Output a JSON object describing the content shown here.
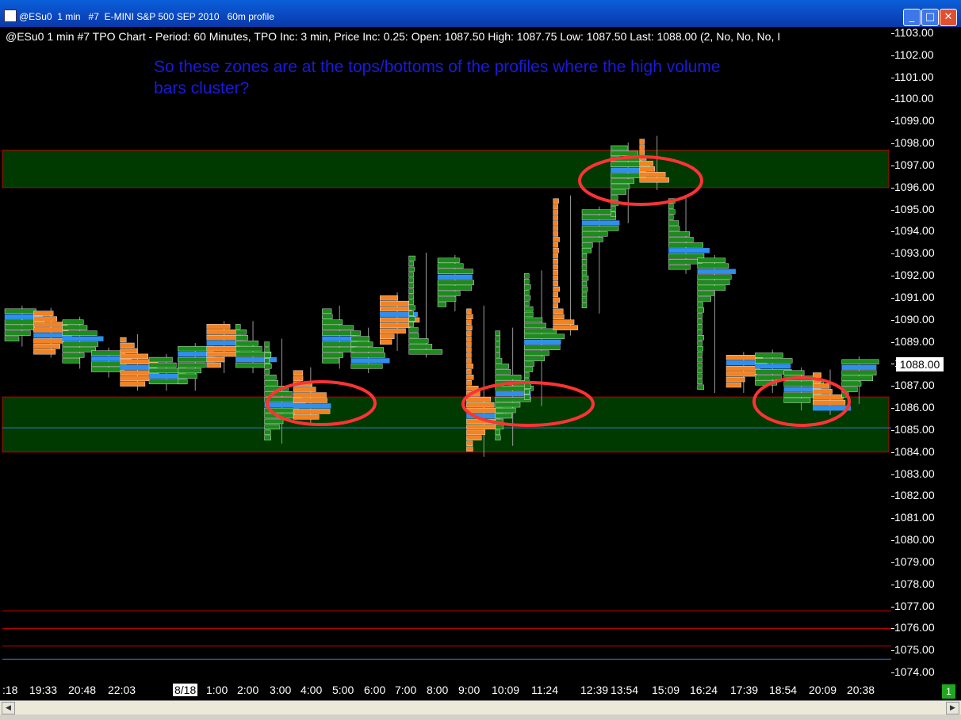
{
  "window": {
    "title": "@ESu0  1 min   #7  E-MINI S&P 500 SEP 2010   60m profile",
    "minimize": "_",
    "maximize": "□",
    "close": "✕"
  },
  "info_line": "@ESu0  1 min  #7 TPO Chart - Period: 60 Minutes, TPO Inc: 3 min, Price Inc: 0.25:  Open: 1087.50  High: 1087.75  Low: 1087.50  Last: 1088.00  (2, No, No, No, I",
  "annotation": {
    "line1": "So these zones are at the tops/bottoms of the profiles where the high volume",
    "line2": "bars cluster?"
  },
  "last_price": "1088.00",
  "status_badge": "1",
  "colors": {
    "background": "#000000",
    "zone_fill": "#003a00",
    "zone_border": "#c00000",
    "red_line": "#d00000",
    "blue_line": "#2a7bd6",
    "tpo_green": "#1c8c1c",
    "tpo_orange": "#f58220",
    "tpo_blue": "#2f8fef",
    "circle": "#ff3333"
  },
  "chart_data": {
    "type": "tpo-profile",
    "ylim": [
      1074,
      1103
    ],
    "y_ticks": [
      "1103.00",
      "1102.00",
      "1101.00",
      "1100.00",
      "1099.00",
      "1098.00",
      "1097.00",
      "1096.00",
      "1095.00",
      "1094.00",
      "1093.00",
      "1092.00",
      "1091.00",
      "1090.00",
      "1089.00",
      "1088.00",
      "1087.00",
      "1086.00",
      "1085.00",
      "1084.00",
      "1083.00",
      "1082.00",
      "1081.00",
      "1080.00",
      "1079.00",
      "1078.00",
      "1077.00",
      "1076.00",
      "1075.00",
      "1074.00"
    ],
    "x_ticks": [
      ":18",
      "19:33",
      "20:48",
      "22:03",
      "8/18",
      "1:00",
      "2:00",
      "3:00",
      "4:00",
      "5:00",
      "6:00",
      "7:00",
      "8:00",
      "9:00",
      "10:09",
      "11:24",
      "12:39",
      "13:54",
      "15:09",
      "16:24",
      "17:39",
      "18:54",
      "20:09",
      "20:38"
    ],
    "zones": [
      {
        "from": 1096.0,
        "to": 1097.7
      },
      {
        "from": 1084.0,
        "to": 1086.5
      }
    ],
    "red_lines": [
      1076.8,
      1076.0,
      1075.2
    ],
    "blue_lines": [
      1085.1,
      1074.6
    ],
    "profiles": [
      {
        "low": 1089.0,
        "high": 1090.5,
        "poc": 1090.2
      },
      {
        "low": 1088.5,
        "high": 1090.4,
        "poc": 1089.5
      },
      {
        "low": 1088.0,
        "high": 1090.0,
        "poc": 1089.2
      },
      {
        "low": 1087.6,
        "high": 1088.6,
        "poc": 1088.3
      },
      {
        "low": 1087.0,
        "high": 1089.2,
        "poc": 1087.9
      },
      {
        "low": 1087.0,
        "high": 1088.3,
        "poc": 1087.5
      },
      {
        "low": 1087.0,
        "high": 1088.8,
        "poc": 1088.5
      },
      {
        "low": 1087.8,
        "high": 1089.8,
        "poc": 1089.1
      },
      {
        "low": 1087.8,
        "high": 1089.8,
        "poc": 1088.3
      },
      {
        "low": 1084.6,
        "high": 1089.0,
        "poc": 1086.3
      },
      {
        "low": 1085.5,
        "high": 1087.7,
        "poc": 1086.3
      },
      {
        "low": 1088.0,
        "high": 1090.5,
        "poc": 1089.2
      },
      {
        "low": 1087.8,
        "high": 1089.5,
        "poc": 1088.3
      },
      {
        "low": 1088.8,
        "high": 1091.1,
        "poc": 1090.3
      },
      {
        "low": 1088.5,
        "high": 1092.9,
        "poc": 1088.3
      },
      {
        "low": 1090.6,
        "high": 1092.8,
        "poc": 1092.0
      },
      {
        "low": 1084.0,
        "high": 1090.5,
        "poc": 1085.8
      },
      {
        "low": 1084.5,
        "high": 1089.5,
        "poc": 1086.8
      },
      {
        "low": 1086.3,
        "high": 1092.1,
        "poc": 1089.2
      },
      {
        "low": 1089.5,
        "high": 1095.5,
        "poc": 1089.2
      },
      {
        "low": 1090.5,
        "high": 1095.0,
        "poc": 1094.6
      },
      {
        "low": 1094.6,
        "high": 1097.9,
        "poc": 1097.0
      },
      {
        "low": 1096.1,
        "high": 1098.2,
        "poc": 1096.0
      },
      {
        "low": 1092.3,
        "high": 1095.5,
        "poc": 1093.2
      },
      {
        "low": 1086.9,
        "high": 1092.8,
        "poc": 1092.2
      },
      {
        "low": 1086.9,
        "high": 1088.4,
        "poc": 1088.2
      },
      {
        "low": 1086.9,
        "high": 1088.5,
        "poc": 1088.0
      },
      {
        "low": 1086.1,
        "high": 1087.7,
        "poc": 1087.0
      },
      {
        "low": 1085.9,
        "high": 1087.6,
        "poc": 1086.1
      },
      {
        "low": 1086.4,
        "high": 1088.2,
        "poc": 1088.0
      }
    ]
  }
}
